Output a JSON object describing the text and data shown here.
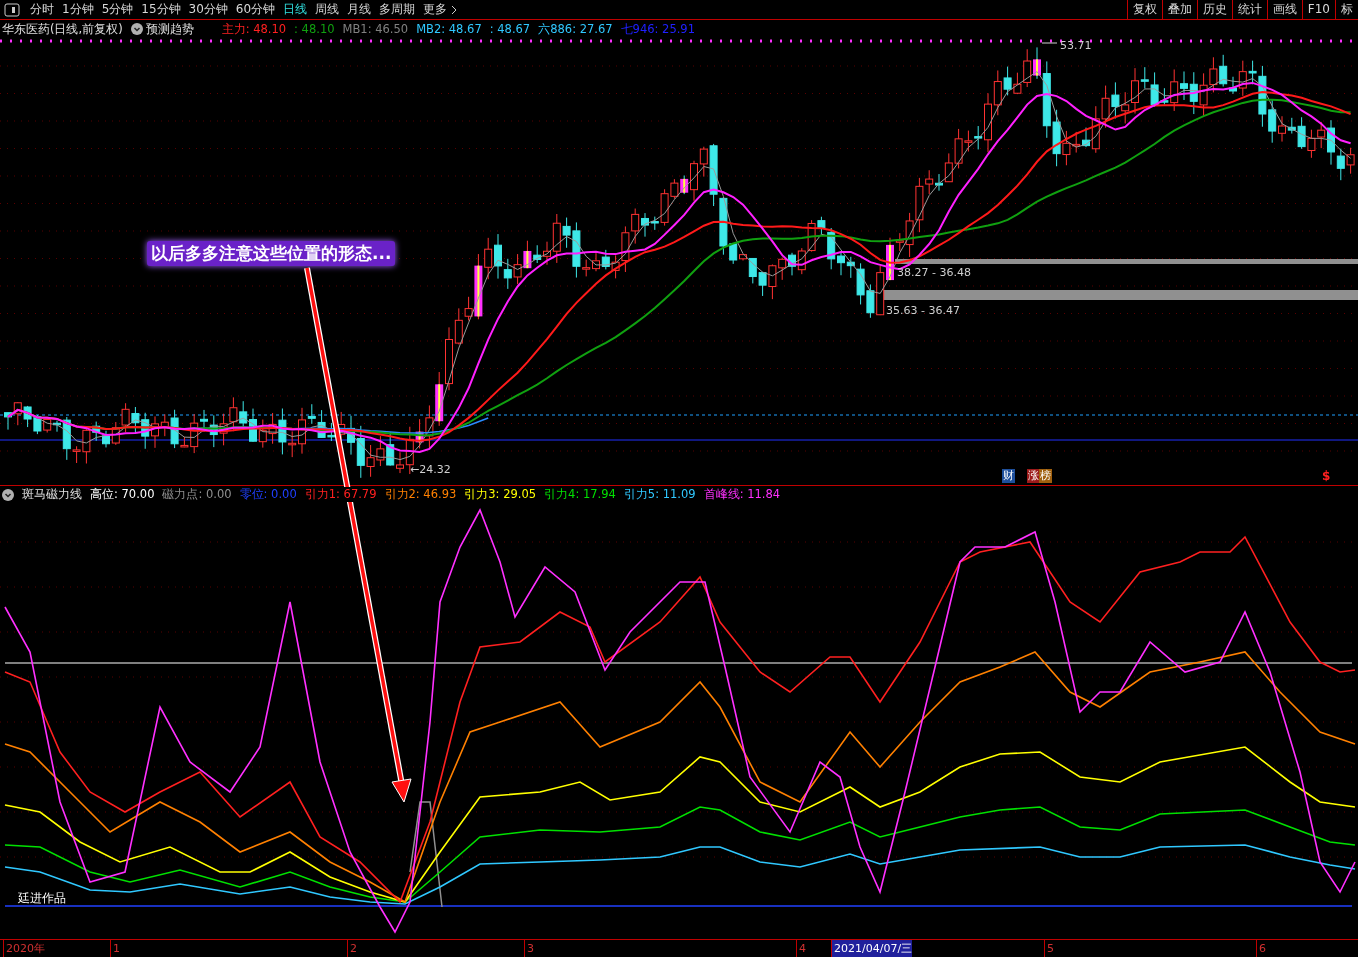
{
  "toolbar": {
    "periods": [
      {
        "label": "分时",
        "selected": false
      },
      {
        "label": "1分钟",
        "selected": false
      },
      {
        "label": "5分钟",
        "selected": false
      },
      {
        "label": "15分钟",
        "selected": false
      },
      {
        "label": "30分钟",
        "selected": false
      },
      {
        "label": "60分钟",
        "selected": false
      },
      {
        "label": "日线",
        "selected": true
      },
      {
        "label": "周线",
        "selected": false
      },
      {
        "label": "月线",
        "selected": false
      },
      {
        "label": "多周期",
        "selected": false
      }
    ],
    "more": "更多",
    "buttons": [
      "复权",
      "叠加",
      "历史",
      "统计",
      "画线",
      "F10",
      "标"
    ]
  },
  "main_legend": {
    "title": "华东医药(日线,前复权)",
    "trend": "预测趋势",
    "items": [
      {
        "text": "主力: 48.10",
        "color": "#ff2020"
      },
      {
        "text": ": 48.10",
        "color": "#10a010"
      },
      {
        "text": "MB1: 46.50",
        "color": "#808080"
      },
      {
        "text": "MB2: 48.67",
        "color": "#30c8ff"
      },
      {
        "text": ": 48.67",
        "color": "#30c8ff"
      },
      {
        "text": "六886: 27.67",
        "color": "#30c8ff"
      },
      {
        "text": "七946: 25.91",
        "color": "#2020ff"
      }
    ]
  },
  "main_chart": {
    "labels": [
      {
        "text": "53.71"
      },
      {
        "text": "←24.32"
      },
      {
        "text": "38.27 - 36.48"
      },
      {
        "text": "35.63 - 36.47"
      }
    ],
    "markers": [
      {
        "text": "财",
        "kind": "badge",
        "color": "#1e4f9c"
      },
      {
        "text": "涨",
        "kind": "badge",
        "color": "#9c1a1a"
      },
      {
        "text": "榜",
        "kind": "badge",
        "color": "#a0600e"
      },
      {
        "text": "$",
        "kind": "signal",
        "color": "#ff2020"
      }
    ]
  },
  "callout": "以后多多注意这些位置的形态...",
  "indicator": {
    "title": "斑马磁力线",
    "items": [
      {
        "text": "高位: 70.00",
        "color": "#ffffff"
      },
      {
        "text": "磁力点: 0.00",
        "color": "#909090"
      },
      {
        "text": "零位: 0.00",
        "color": "#2040ff"
      },
      {
        "text": "引力1: 67.79",
        "color": "#ff2020"
      },
      {
        "text": "引力2: 46.93",
        "color": "#ff8000"
      },
      {
        "text": "引力3: 29.05",
        "color": "#ffff00"
      },
      {
        "text": "引力4: 17.94",
        "color": "#00e000"
      },
      {
        "text": "引力5: 11.09",
        "color": "#30c8ff"
      },
      {
        "text": "首峰线: 11.84",
        "color": "#ff30ff"
      }
    ],
    "signature": "廷进作品"
  },
  "time_axis": [
    {
      "text": "2020年",
      "kind": "tick"
    },
    {
      "text": "1",
      "kind": "tick"
    },
    {
      "text": "2",
      "kind": "tick"
    },
    {
      "text": "3",
      "kind": "tick"
    },
    {
      "text": "4",
      "kind": "tick"
    },
    {
      "text": "2021/04/07/三",
      "kind": "cursor"
    },
    {
      "text": "5",
      "kind": "tick"
    },
    {
      "text": "6",
      "kind": "tick"
    }
  ]
}
